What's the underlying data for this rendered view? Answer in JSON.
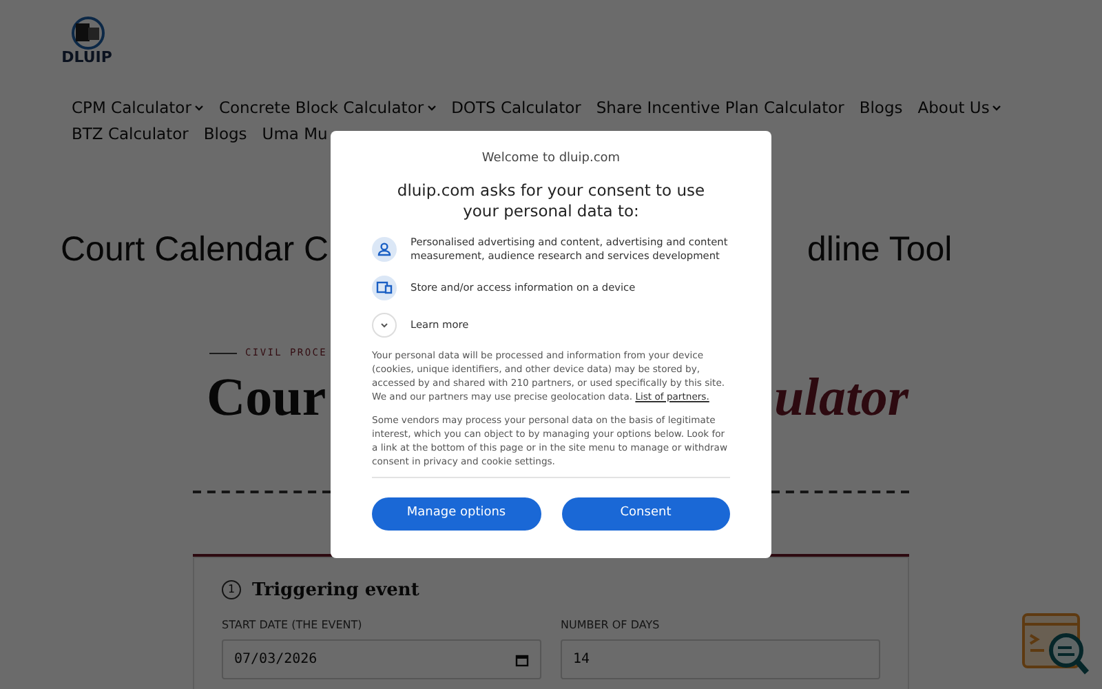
{
  "header": {
    "logo_text": "DLUIP"
  },
  "nav": {
    "row_1": [
      {
        "label": "CPM Calculator",
        "has_menu": true
      },
      {
        "label": "Concrete Block Calculator",
        "has_menu": true
      },
      {
        "label": "DOTS Calculator",
        "has_menu": false
      },
      {
        "label": "Share Incentive Plan Calculator",
        "has_menu": false
      },
      {
        "label": "Blogs",
        "has_menu": false
      },
      {
        "label": "About Us",
        "has_menu": true
      }
    ],
    "row_2": [
      {
        "label": "BTZ Calculator"
      },
      {
        "label": "Blogs"
      },
      {
        "label": "Uma Mu"
      }
    ]
  },
  "page_title": {
    "left": "Court Calendar C",
    "right": "dline Tool"
  },
  "hero": {
    "eyebrow": "CIVIL PROCE",
    "title_left": "Cour",
    "title_right": "ulator"
  },
  "form": {
    "step": "1",
    "section_title": "Triggering event",
    "fields": [
      {
        "label": "START DATE (THE EVENT)",
        "value": "07/03/2026",
        "kind": "date"
      },
      {
        "label": "NUMBER OF DAYS",
        "value": "14",
        "kind": "text"
      }
    ]
  },
  "consent_dialog": {
    "welcome": "Welcome to dluip.com",
    "heading": "dluip.com asks for your consent to use your personal data to:",
    "purposes": [
      {
        "kind": "person",
        "text": "Personalised advertising and content, advertising and content measurement, audience research and services development"
      },
      {
        "kind": "device",
        "text": "Store and/or access information on a device"
      }
    ],
    "learn_more": {
      "label": "Learn more",
      "expanded": false
    },
    "paragraph_1": "Your personal data will be processed and information from your device (cookies, unique identifiers, and other device data) may be stored by, accessed by and shared with 210 partners, or used specifically by this site. We and our partners may use precise geolocation data.",
    "partners_link": "List of partners.",
    "paragraph_2": "Some vendors may process your personal data on the basis of legitimate interest, which you can object to by managing your options below. Look for a link at the bottom of this page or in the site menu to manage or withdraw consent in privacy and cookie settings.",
    "buttons": [
      "Manage options",
      "Consent"
    ]
  }
}
